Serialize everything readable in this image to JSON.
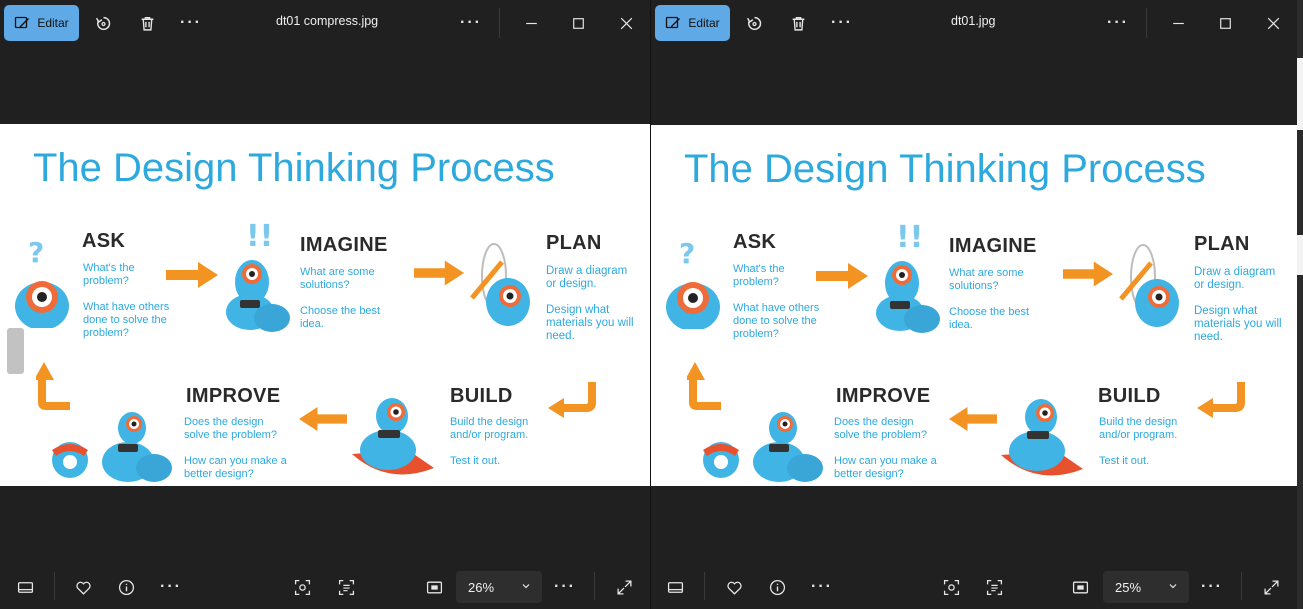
{
  "left_window": {
    "edit_label": "Editar",
    "file_name": "dt01 compress.jpg",
    "zoom_level": "26%"
  },
  "right_window": {
    "edit_label": "Editar",
    "file_name": "dt01.jpg",
    "zoom_level": "25%"
  },
  "image": {
    "title": "The Design Thinking Process",
    "steps": {
      "ask": {
        "heading": "ASK",
        "text": "What's the\nproblem?\n\nWhat have others\ndone to solve the\nproblem?"
      },
      "imagine": {
        "heading": "IMAGINE",
        "text": "What are some\nsolutions?\n\nChoose the best\nidea."
      },
      "plan": {
        "heading": "PLAN",
        "text": "Draw a diagram\nor design.\n\nDesign what\nmaterials you will\nneed."
      },
      "build": {
        "heading": "BUILD",
        "text": "Build the design\nand/or program.\n\nTest it out."
      },
      "improve": {
        "heading": "IMPROVE",
        "text": "Does the design\nsolve the problem?\n\nHow can you make a\nbetter design?"
      }
    },
    "colors": {
      "title_blue": "#2ea9de",
      "arrow_orange": "#f39322",
      "robot_blue": "#40b4e5",
      "robot_orange": "#f06b3a"
    }
  },
  "icons": {
    "edit": "edit-image-icon",
    "rotate": "rotate-icon",
    "delete": "trash-icon",
    "more": "more-icon",
    "minimize": "minimize-icon",
    "maximize": "maximize-icon",
    "close": "close-icon",
    "filmstrip": "filmstrip-icon",
    "favorite": "heart-icon",
    "info": "info-icon",
    "face": "face-detect-icon",
    "text": "text-scan-icon",
    "fit": "fit-view-icon",
    "zoom_chevron": "chevron-down-icon",
    "fullscreen": "fullscreen-icon"
  }
}
